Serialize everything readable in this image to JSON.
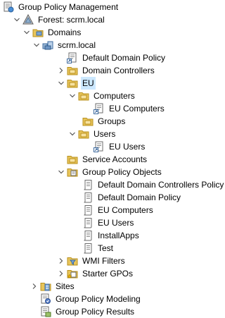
{
  "tree": {
    "root": {
      "label": "Group Policy Management"
    },
    "forest": {
      "label": "Forest: scrm.local"
    },
    "domains": {
      "label": "Domains"
    },
    "domain": {
      "label": "scrm.local"
    },
    "default_domain_policy_link": {
      "label": "Default Domain Policy"
    },
    "domain_controllers": {
      "label": "Domain Controllers"
    },
    "eu": {
      "label": "EU"
    },
    "computers": {
      "label": "Computers"
    },
    "eu_computers_link": {
      "label": "EU Computers"
    },
    "groups": {
      "label": "Groups"
    },
    "users": {
      "label": "Users"
    },
    "eu_users_link": {
      "label": "EU Users"
    },
    "service_accounts": {
      "label": "Service Accounts"
    },
    "gpo_container": {
      "label": "Group Policy Objects"
    },
    "gpos": [
      {
        "label": "Default Domain Controllers Policy"
      },
      {
        "label": "Default Domain Policy"
      },
      {
        "label": "EU Computers"
      },
      {
        "label": "EU Users"
      },
      {
        "label": "InstallApps"
      },
      {
        "label": "Test"
      }
    ],
    "wmi_filters": {
      "label": "WMI Filters"
    },
    "starter_gpos": {
      "label": "Starter GPOs"
    },
    "sites": {
      "label": "Sites"
    },
    "modeling": {
      "label": "Group Policy Modeling"
    },
    "results": {
      "label": "Group Policy Results"
    }
  },
  "selected_item": "EU",
  "colors": {
    "selection": "#cce8ff",
    "folder": "#e8c55a",
    "folder_dark": "#c79a2a",
    "text": "#000000",
    "chevron": "#555555"
  }
}
